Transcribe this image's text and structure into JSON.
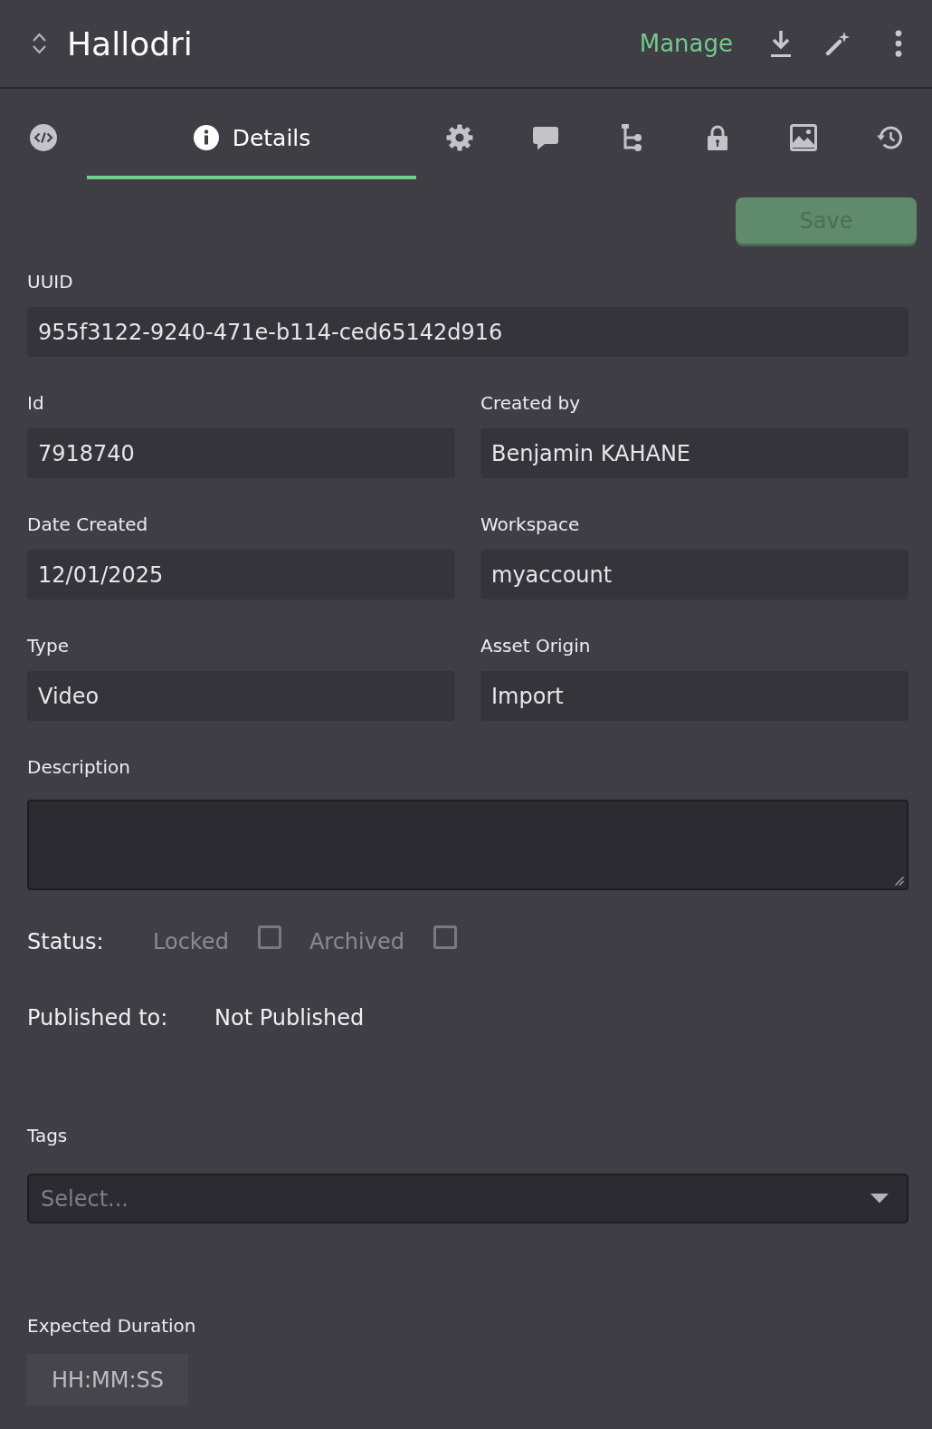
{
  "header": {
    "title": "Hallodri",
    "manage_link": "Manage"
  },
  "tabs": [
    {
      "kind": "code",
      "selected": false
    },
    {
      "kind": "info",
      "label": "Details",
      "selected": true
    },
    {
      "kind": "gear",
      "selected": false
    },
    {
      "kind": "comment",
      "selected": false
    },
    {
      "kind": "tree",
      "selected": false
    },
    {
      "kind": "lock",
      "selected": false
    },
    {
      "kind": "image",
      "selected": false
    },
    {
      "kind": "history",
      "selected": false
    }
  ],
  "save_button": {
    "label": "Save",
    "disabled": true
  },
  "uuid": {
    "label": "UUID",
    "value": "955f3122-9240-471e-b114-ced65142d916"
  },
  "details": [
    {
      "label": "Id",
      "value": "7918740"
    },
    {
      "label": "Created by",
      "value": "Benjamin KAHANE"
    },
    {
      "label": "Date Created",
      "value": "12/01/2025"
    },
    {
      "label": "Workspace",
      "value": "myaccount"
    },
    {
      "label": "Type",
      "value": "Video"
    },
    {
      "label": "Asset Origin",
      "value": "Import"
    }
  ],
  "description": {
    "label": "Description"
  },
  "status": {
    "label": "Status:",
    "options": [
      {
        "label": "Locked",
        "checked": false,
        "disabled": true
      },
      {
        "label": "Archived",
        "checked": false,
        "disabled": true
      }
    ]
  },
  "published": {
    "label": "Published to:",
    "value": "Not Published"
  },
  "tags": {
    "label": "Tags",
    "placeholder": "Select..."
  },
  "expected_duration": {
    "label": "Expected Duration",
    "placeholder": "HH:MM:SS"
  }
}
